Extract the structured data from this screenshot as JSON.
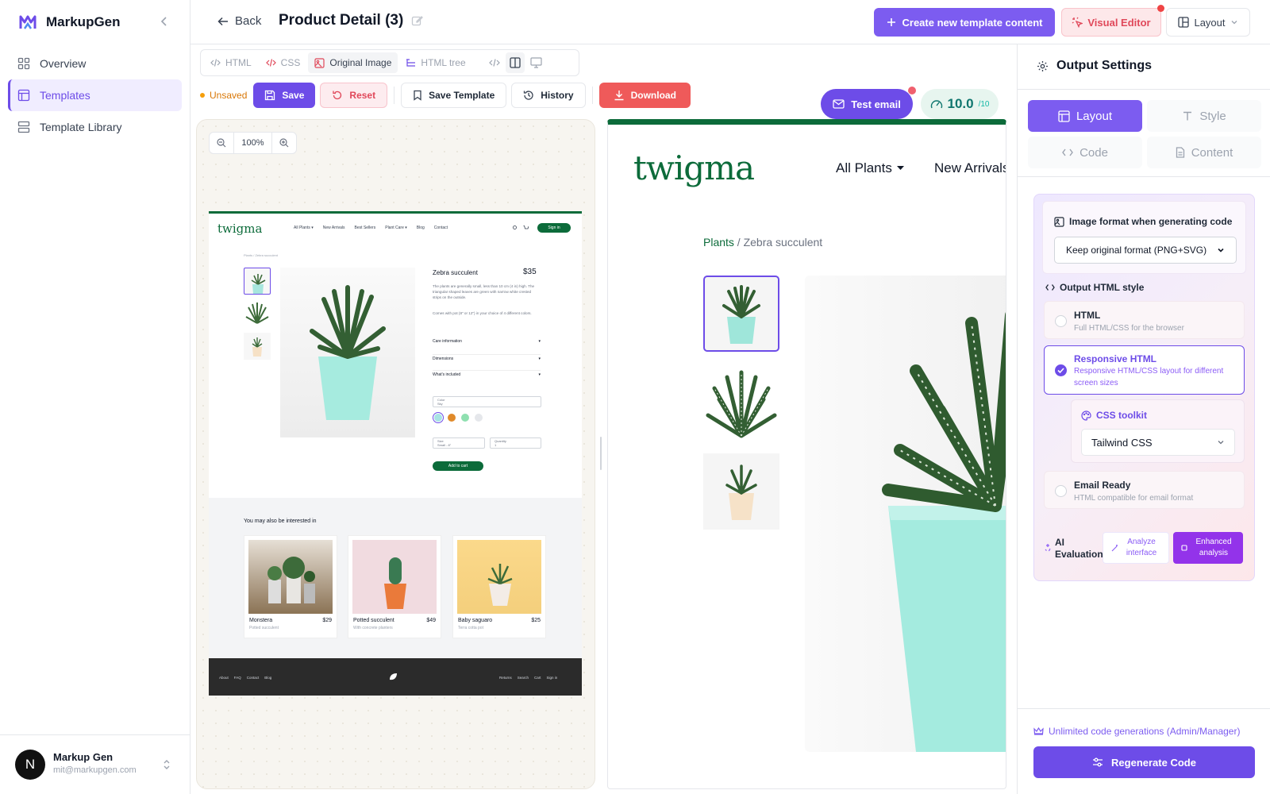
{
  "app": {
    "name": "MarkupGen"
  },
  "sidebar": {
    "items": [
      {
        "label": "Overview"
      },
      {
        "label": "Templates"
      },
      {
        "label": "Template Library"
      }
    ]
  },
  "user": {
    "initial": "N",
    "name": "Markup Gen",
    "email": "mit@markupgen.com"
  },
  "header": {
    "back_label": "Back",
    "title": "Product Detail (3)",
    "create_label": "Create new template content",
    "visual_editor_label": "Visual Editor",
    "layout_label": "Layout"
  },
  "view_tabs": [
    {
      "label": "HTML"
    },
    {
      "label": "CSS"
    },
    {
      "label": "Original Image"
    },
    {
      "label": "HTML tree"
    }
  ],
  "toolbar": {
    "unsaved_label": "Unsaved",
    "save_label": "Save",
    "reset_label": "Reset",
    "save_template_label": "Save Template",
    "history_label": "History",
    "download_label": "Download",
    "test_email_label": "Test email",
    "score": "10.0",
    "score_max": "/10"
  },
  "zoom": {
    "level": "100%"
  },
  "original": {
    "brand": "twigma",
    "nav": [
      "All Plants ▾",
      "New Arrivals",
      "Best Sellers",
      "Plant Care ▾",
      "Blog",
      "Contact"
    ],
    "signin": "Sign in",
    "breadcrumb": "Plants / Zebra succulent",
    "product_name": "Zebra succulent",
    "price": "$35",
    "desc1": "The plants are generally small, less than 10 cm (4 in) high. The triangular shaped leaves are green with narrow white crested strips on the outside.",
    "desc2": "Comes with pot (8\" or 12\") in your choice of 4 different colors.",
    "accordions": [
      "Care information",
      "Dimensions",
      "What's included"
    ],
    "color_label": "Color",
    "color_value": "Sky",
    "size_label": "Size",
    "size_value": "Small - 8\"",
    "qty_label": "Quantity",
    "qty_value": "1",
    "cart_label": "Add to cart",
    "related_title": "You may also be interested in",
    "related": [
      {
        "name": "Monstera",
        "price": "$29",
        "sub": "Potted succulent"
      },
      {
        "name": "Potted succulent",
        "price": "$49",
        "sub": "With concrete planters"
      },
      {
        "name": "Baby saguaro",
        "price": "$25",
        "sub": "Terra cotta pot"
      }
    ],
    "footer_left": [
      "About",
      "FAQ",
      "Contact",
      "Blog"
    ],
    "footer_right": [
      "Returns",
      "Search",
      "Cart",
      "Sign in"
    ],
    "swatches": [
      "#a7e3e3",
      "#e08a2a",
      "#8fe0b0",
      "#e5e7eb"
    ]
  },
  "preview": {
    "brand": "twigma",
    "nav": [
      "All Plants",
      "New Arrivals"
    ],
    "breadcrumb_link": "Plants",
    "breadcrumb_rest": " / Zebra succulent"
  },
  "settings": {
    "title": "Output Settings",
    "tabs": [
      {
        "label": "Layout"
      },
      {
        "label": "Style"
      },
      {
        "label": "Code"
      },
      {
        "label": "Content"
      }
    ],
    "image_format_label": "Image format when generating code",
    "image_format_value": "Keep original format (PNG+SVG)",
    "output_style_label": "Output HTML style",
    "options": [
      {
        "title": "HTML",
        "desc": "Full HTML/CSS for the browser"
      },
      {
        "title": "Responsive HTML",
        "desc": "Responsive HTML/CSS layout for different screen sizes"
      },
      {
        "title": "Email Ready",
        "desc": "HTML compatible for email format"
      }
    ],
    "toolkit_label": "CSS toolkit",
    "toolkit_value": "Tailwind CSS",
    "ai_label": "AI Evaluation",
    "analyze_label": "Analyze interface",
    "enhanced_label": "Enhanced analysis",
    "unlimited_label": "Unlimited code generations (Admin/Manager)",
    "regenerate_label": "Regenerate Code"
  },
  "colors": {
    "accent": "#6d4ce8",
    "brand_green": "#0c6b3a",
    "danger": "#ef5a5a"
  }
}
